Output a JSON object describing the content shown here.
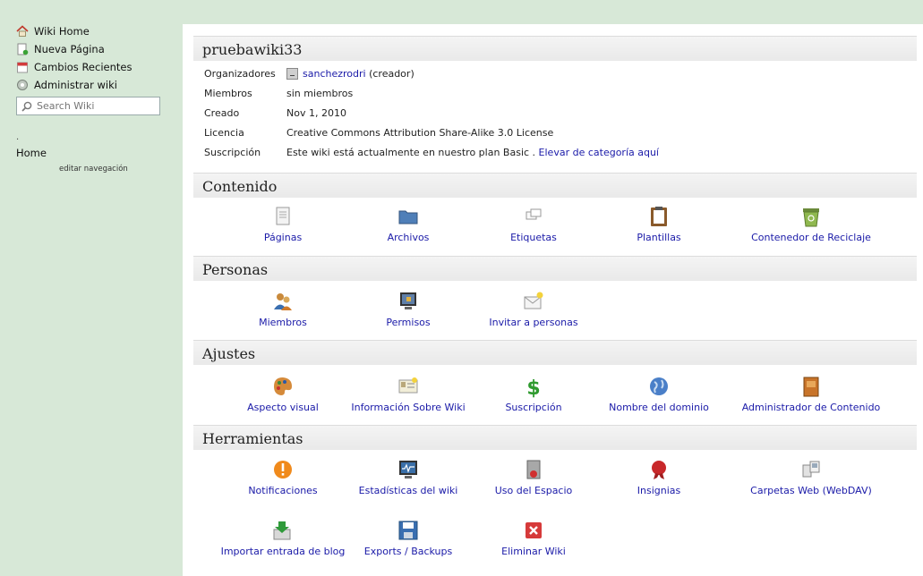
{
  "sidebar": {
    "items": [
      {
        "label": "Wiki Home",
        "icon": "home-icon"
      },
      {
        "label": "Nueva Página",
        "icon": "new-page-icon"
      },
      {
        "label": "Cambios Recientes",
        "icon": "calendar-icon"
      },
      {
        "label": "Administrar wiki",
        "icon": "admin-icon"
      }
    ],
    "search_placeholder": "Search Wiki",
    "dot": ".",
    "home_label": "Home",
    "edit_nav_label": "editar navegación"
  },
  "wiki": {
    "title": "pruebawiki33",
    "info": [
      {
        "key": "Organizadores",
        "value": "sanchezrodri",
        "suffix": " (creador)"
      },
      {
        "key": "Miembros",
        "value": "sin miembros"
      },
      {
        "key": "Creado",
        "value": "Nov 1, 2010"
      },
      {
        "key": "Licencia",
        "value": "Creative Commons Attribution Share-Alike 3.0 License"
      },
      {
        "key": "Suscripción",
        "value": "Este wiki está actualmente en nuestro plan Basic . ",
        "link": "Elevar de categoría aquí"
      }
    ]
  },
  "sections": [
    {
      "title": "Contenido",
      "items": [
        {
          "label": "Páginas",
          "icon": "pages-icon"
        },
        {
          "label": "Archivos",
          "icon": "folder-icon"
        },
        {
          "label": "Etiquetas",
          "icon": "tags-icon"
        },
        {
          "label": "Plantillas",
          "icon": "clipboard-icon"
        },
        {
          "label": "Contenedor de Reciclaje",
          "icon": "recycle-bin-icon"
        }
      ]
    },
    {
      "title": "Personas",
      "items": [
        {
          "label": "Miembros",
          "icon": "members-icon"
        },
        {
          "label": "Permisos",
          "icon": "lock-monitor-icon"
        },
        {
          "label": "Invitar a personas",
          "icon": "invite-envelope-icon"
        }
      ]
    },
    {
      "title": "Ajustes",
      "items": [
        {
          "label": "Aspecto visual",
          "icon": "palette-icon"
        },
        {
          "label": "Información Sobre Wiki",
          "icon": "wiki-info-icon"
        },
        {
          "label": "Suscripción",
          "icon": "dollar-icon"
        },
        {
          "label": "Nombre del dominio",
          "icon": "globe-icon"
        },
        {
          "label": "Administrador de Contenido",
          "icon": "book-icon"
        }
      ]
    },
    {
      "title": "Herramientas",
      "items": [
        {
          "label": "Notificaciones",
          "icon": "alert-icon"
        },
        {
          "label": "Estadísticas del wiki",
          "icon": "stats-monitor-icon"
        },
        {
          "label": "Uso del Espacio",
          "icon": "disk-usage-icon"
        },
        {
          "label": "Insignias",
          "icon": "badge-icon"
        },
        {
          "label": "Carpetas Web (WebDAV)",
          "icon": "webdav-icon"
        },
        {
          "label": "Importar entrada de blog",
          "icon": "import-icon"
        },
        {
          "label": "Exports / Backups",
          "icon": "save-icon"
        },
        {
          "label": "Eliminar Wiki",
          "icon": "delete-icon"
        }
      ]
    }
  ]
}
